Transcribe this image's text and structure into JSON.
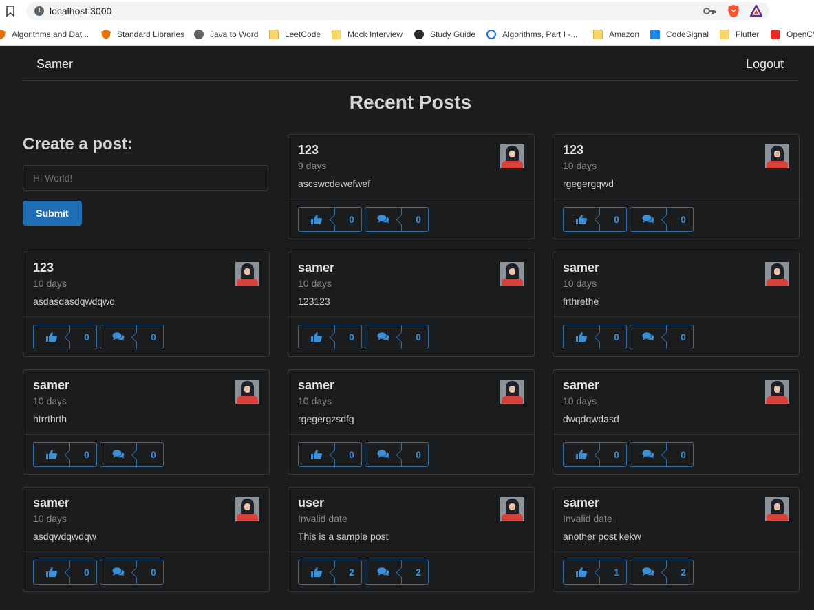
{
  "browser": {
    "url": "localhost:3000",
    "bookmarks": [
      {
        "label": "Algorithms and Dat...",
        "icon": "shield-icon"
      },
      {
        "label": "Standard Libraries",
        "icon": "shield-icon"
      },
      {
        "label": "Java to Word",
        "icon": "globe-icon"
      },
      {
        "label": "LeetCode",
        "icon": "folder-icon"
      },
      {
        "label": "Mock Interview",
        "icon": "folder-icon"
      },
      {
        "label": "Study Guide",
        "icon": "github-icon"
      },
      {
        "label": "Algorithms, Part I -...",
        "icon": "coursera-icon"
      },
      {
        "label": "Amazon",
        "icon": "folder-icon"
      },
      {
        "label": "CodeSignal",
        "icon": "codesignal-icon"
      },
      {
        "label": "Flutter",
        "icon": "folder-icon"
      },
      {
        "label": "OpenCV",
        "icon": "youtube-icon"
      }
    ]
  },
  "nav": {
    "brand": "Samer",
    "logout": "Logout"
  },
  "page": {
    "title": "Recent Posts"
  },
  "create": {
    "title": "Create a post:",
    "placeholder": "Hi World!",
    "submit": "Submit"
  },
  "colors": {
    "background": "#1b1c1d",
    "accent": "#2185d0",
    "button": "#1f6db3"
  },
  "posts": [
    {
      "author": "123",
      "date": "9 days",
      "body": "ascswcdewefwef",
      "likes": "0",
      "comments": "0"
    },
    {
      "author": "123",
      "date": "10 days",
      "body": "rgegergqwd",
      "likes": "0",
      "comments": "0"
    },
    {
      "author": "123",
      "date": "10 days",
      "body": "asdasdasdqwdqwd",
      "likes": "0",
      "comments": "0"
    },
    {
      "author": "samer",
      "date": "10 days",
      "body": "123123",
      "likes": "0",
      "comments": "0"
    },
    {
      "author": "samer",
      "date": "10 days",
      "body": "frthrethe",
      "likes": "0",
      "comments": "0"
    },
    {
      "author": "samer",
      "date": "10 days",
      "body": "htrrthrth",
      "likes": "0",
      "comments": "0"
    },
    {
      "author": "samer",
      "date": "10 days",
      "body": "rgegergzsdfg",
      "likes": "0",
      "comments": "0"
    },
    {
      "author": "samer",
      "date": "10 days",
      "body": "dwqdqwdasd",
      "likes": "0",
      "comments": "0"
    },
    {
      "author": "samer",
      "date": "10 days",
      "body": "asdqwdqwdqw",
      "likes": "0",
      "comments": "0"
    },
    {
      "author": "user",
      "date": "Invalid date",
      "body": "This is a sample post",
      "likes": "2",
      "comments": "2"
    },
    {
      "author": "samer",
      "date": "Invalid date",
      "body": "another post kekw",
      "likes": "1",
      "comments": "2"
    }
  ]
}
